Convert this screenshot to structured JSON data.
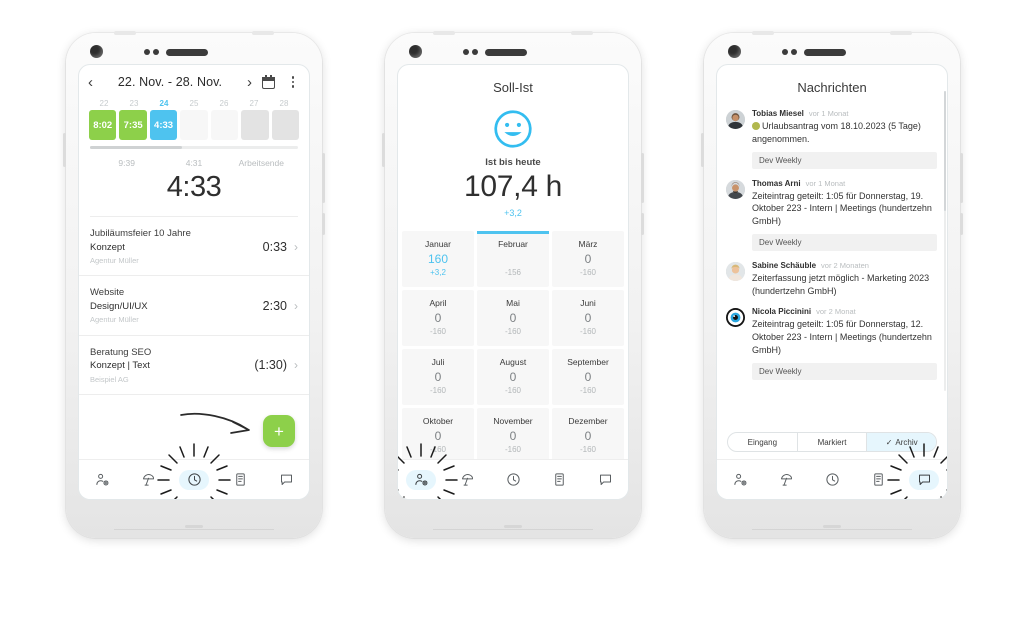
{
  "phone1": {
    "header": {
      "prev": "‹",
      "date_range": "22. Nov. - 28. Nov.",
      "next": "›",
      "calendar_icon": "calendar-icon",
      "menu_icon": "kebab-menu-icon"
    },
    "week": {
      "days": [
        "22",
        "23",
        "24",
        "25",
        "26",
        "27",
        "28"
      ],
      "active_day": "24",
      "bars": [
        {
          "label": "8:02",
          "style": "green"
        },
        {
          "label": "7:35",
          "style": "green"
        },
        {
          "label": "4:33",
          "style": "blue"
        },
        {
          "label": "",
          "style": "empty"
        },
        {
          "label": "",
          "style": "empty"
        },
        {
          "label": "",
          "style": "grey"
        },
        {
          "label": "",
          "style": "grey"
        }
      ]
    },
    "summary": {
      "start": "9:39",
      "middle": "4:31",
      "end_label": "Arbeitsende",
      "total": "4:33"
    },
    "tasks": [
      {
        "project": "Jubiläumsfeier 10 Jahre",
        "task": "Konzept",
        "client": "Agentur Müller",
        "value": "0:33",
        "chevron": "›"
      },
      {
        "project": "Website",
        "task": "Design/UI/UX",
        "client": "Agentur Müller",
        "value": "2:30",
        "chevron": "›"
      },
      {
        "project": "Beratung SEO",
        "task": "Konzept | Text",
        "client": "Beispiel AG",
        "value": "(1:30)",
        "chevron": "›"
      }
    ],
    "fab_label": "+",
    "nav": [
      {
        "icon": "person-add-icon",
        "selected": false
      },
      {
        "icon": "beach-umbrella-icon",
        "selected": false
      },
      {
        "icon": "clock-icon",
        "selected": true
      },
      {
        "icon": "receipt-icon",
        "selected": false
      },
      {
        "icon": "chat-bubble-icon",
        "selected": false
      }
    ]
  },
  "phone2": {
    "title": "Soll-Ist",
    "smiley_icon": "smiley-face-icon",
    "subtitle": "Ist bis heute",
    "total": "107,4 h",
    "delta": "+3,2",
    "months": [
      {
        "name": "Januar",
        "value": "160",
        "delta": "+3,2",
        "highlight": true,
        "selected": false
      },
      {
        "name": "Februar",
        "value": "",
        "delta": "-156",
        "highlight": false,
        "selected": true
      },
      {
        "name": "März",
        "value": "0",
        "delta": "-160",
        "highlight": false,
        "selected": false
      },
      {
        "name": "April",
        "value": "0",
        "delta": "-160",
        "highlight": false,
        "selected": false
      },
      {
        "name": "Mai",
        "value": "0",
        "delta": "-160",
        "highlight": false,
        "selected": false
      },
      {
        "name": "Juni",
        "value": "0",
        "delta": "-160",
        "highlight": false,
        "selected": false
      },
      {
        "name": "Juli",
        "value": "0",
        "delta": "-160",
        "highlight": false,
        "selected": false
      },
      {
        "name": "August",
        "value": "0",
        "delta": "-160",
        "highlight": false,
        "selected": false
      },
      {
        "name": "September",
        "value": "0",
        "delta": "-160",
        "highlight": false,
        "selected": false
      },
      {
        "name": "Oktober",
        "value": "0",
        "delta": "-160",
        "highlight": false,
        "selected": false
      },
      {
        "name": "November",
        "value": "0",
        "delta": "-160",
        "highlight": false,
        "selected": false
      },
      {
        "name": "Dezember",
        "value": "0",
        "delta": "-160",
        "highlight": false,
        "selected": false
      }
    ],
    "nav": [
      {
        "icon": "person-add-icon",
        "selected": true
      },
      {
        "icon": "beach-umbrella-icon",
        "selected": false
      },
      {
        "icon": "clock-icon",
        "selected": false
      },
      {
        "icon": "receipt-icon",
        "selected": false
      },
      {
        "icon": "chat-bubble-icon",
        "selected": false
      }
    ]
  },
  "phone3": {
    "title": "Nachrichten",
    "messages": [
      {
        "author": "Tobias Miesel",
        "time": "vor 1 Monat",
        "text": "Urlaubsantrag vom 18.10.2023 (5 Tage) angenommen.",
        "has_emoji": true,
        "tag": "Dev Weekly",
        "avatar": "photo-avatar-male-1"
      },
      {
        "author": "Thomas Arni",
        "time": "vor 1 Monat",
        "text": "Zeiteintrag geteilt: 1:05 für Donnerstag, 19. Oktober 223 - Intern | Meetings (hundertzehn GmbH)",
        "has_emoji": false,
        "tag": "Dev Weekly",
        "avatar": "photo-avatar-male-2"
      },
      {
        "author": "Sabine Schäuble",
        "time": "vor 2 Monaten",
        "text": "Zeiterfassung jetzt möglich - Marketing 2023 (hundertzehn GmbH)",
        "has_emoji": false,
        "tag": "",
        "avatar": "photo-avatar-female-1"
      },
      {
        "author": "Nicola Piccinini",
        "time": "vor 2 Monat",
        "text": "Zeiteintrag geteilt: 1:05 für Donnerstag, 12. Oktober 223 - Intern | Meetings (hundertzehn GmbH)",
        "has_emoji": false,
        "tag": "Dev Weekly",
        "avatar": "eye-logo-avatar"
      }
    ],
    "segments": [
      {
        "label": "Eingang",
        "active": false,
        "check": ""
      },
      {
        "label": "Markiert",
        "active": false,
        "check": ""
      },
      {
        "label": "Archiv",
        "active": true,
        "check": "✓"
      }
    ],
    "nav": [
      {
        "icon": "person-add-icon",
        "selected": false
      },
      {
        "icon": "beach-umbrella-icon",
        "selected": false
      },
      {
        "icon": "clock-icon",
        "selected": false
      },
      {
        "icon": "receipt-icon",
        "selected": false
      },
      {
        "icon": "chat-bubble-icon",
        "selected": true
      }
    ]
  },
  "colors": {
    "green": "#8dd04a",
    "blue": "#4ec3ef",
    "grey": "#e3e3e3",
    "text": "#2f2f2f"
  }
}
